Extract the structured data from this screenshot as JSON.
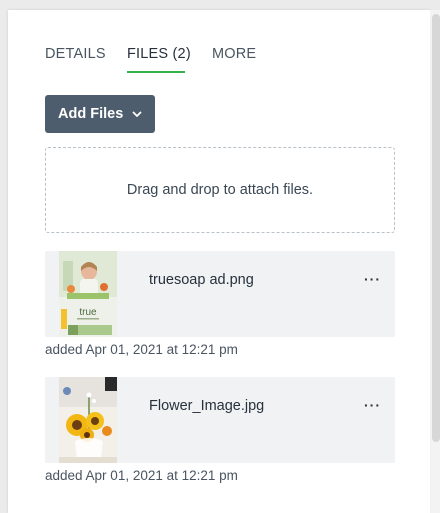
{
  "tabs": [
    {
      "label": "DETAILS",
      "active": false
    },
    {
      "label": "FILES (2)",
      "active": true
    },
    {
      "label": "MORE",
      "active": false
    }
  ],
  "toolbar": {
    "add_files_label": "Add Files",
    "add_files_icon": "chevron-down-icon"
  },
  "dropzone": {
    "text": "Drag and drop to attach files."
  },
  "files": [
    {
      "name": "truesoap ad.png",
      "added": "added Apr 01, 2021 at 12:21 pm",
      "menu": "···",
      "thumb_text": "true"
    },
    {
      "name": "Flower_Image.jpg",
      "added": "added Apr 01, 2021 at 12:21 pm",
      "menu": "···"
    }
  ],
  "colors": {
    "accent_underline": "#35b34a",
    "button_bg": "#4d5d6d",
    "card_bg": "#f1f2f4"
  }
}
